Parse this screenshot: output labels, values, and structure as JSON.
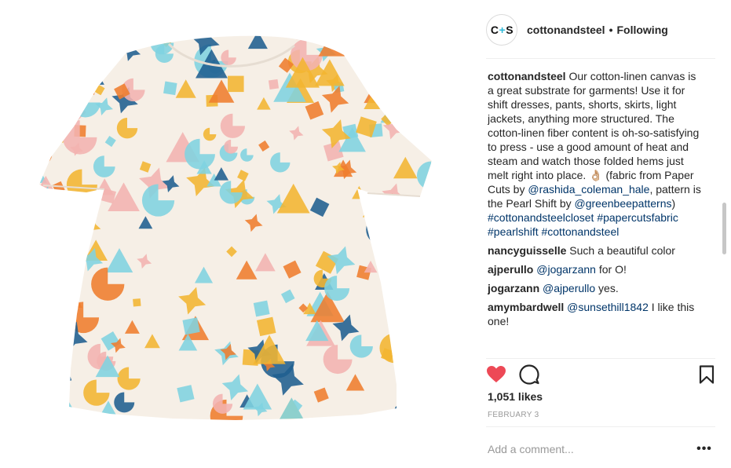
{
  "post": {
    "image_alt": "shift-dress-photo",
    "colors": {
      "fabric": "#f6efe6",
      "orange": "#ef7d2d",
      "yellow": "#f2b531",
      "navy": "#1f5f8f",
      "aqua": "#7fd3e0",
      "pink": "#f3b3b0"
    }
  },
  "header": {
    "avatar_text_left": "C",
    "avatar_text_plus": "+",
    "avatar_text_right": "S",
    "username": "cottonandsteel",
    "dot": "•",
    "follow_label": "Following"
  },
  "caption": {
    "username": "cottonandsteel",
    "text_1": " Our cotton-linen canvas is a great substrate for garments! Use it for shift dresses, pants, shorts, skirts, light jackets, anything more structured. The cotton-linen fiber content is oh-so-satisfying to press - use a good amount of heat and steam and watch those folded hems just melt right into place. 👌🏼 (fabric from Paper Cuts by ",
    "mention_1": "@rashida_coleman_hale",
    "text_2": ", pattern is the Pearl Shift by ",
    "mention_2": "@greenbeepatterns",
    "text_3": ")",
    "hashtags": "#cottonandsteelcloset #papercutsfabric #pearlshift #cottonandsteel"
  },
  "comments": [
    {
      "user": "nancyguisselle",
      "pre": " Such a beautiful color",
      "mention": "",
      "post": ""
    },
    {
      "user": "ajperullo",
      "pre": " ",
      "mention": "@jogarzann",
      "post": " for O!"
    },
    {
      "user": "jogarzann",
      "pre": " ",
      "mention": "@ajperullo",
      "post": " yes."
    },
    {
      "user": "amymbardwell",
      "pre": " ",
      "mention": "@sunsethill1842",
      "post": " I like this one!"
    }
  ],
  "actions": {
    "like_icon": "heart-icon",
    "comment_icon": "comment-icon",
    "save_icon": "bookmark-icon",
    "like_color": "#ed4956"
  },
  "likes_text": "1,051 likes",
  "date_text": "FEBRUARY 3",
  "add_comment_placeholder": "Add a comment...",
  "more_label": "•••"
}
